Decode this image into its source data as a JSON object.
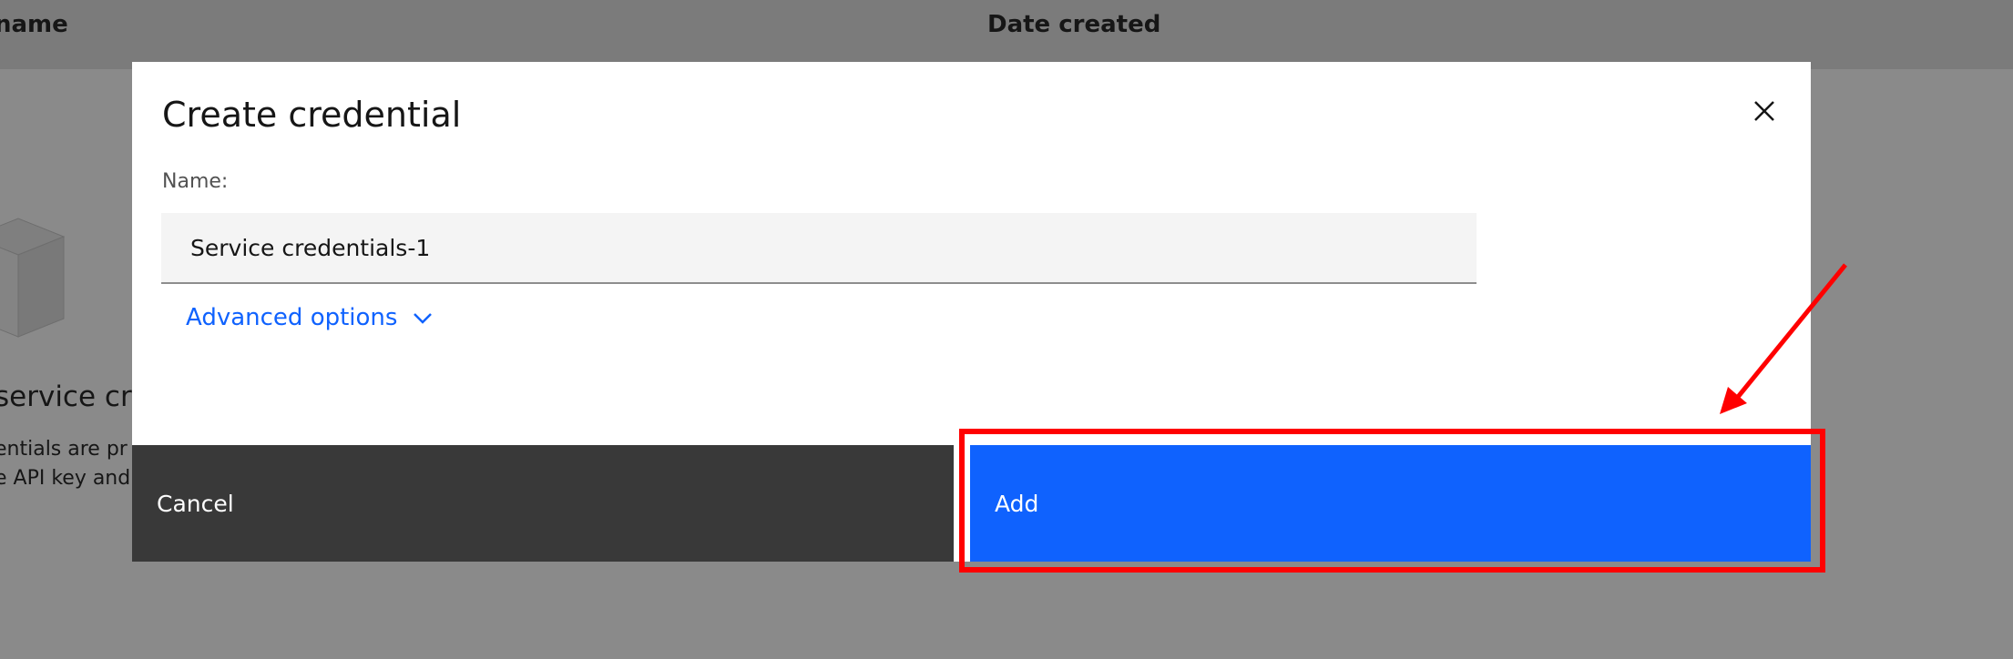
{
  "background": {
    "table": {
      "col_name": "name",
      "col_date": "Date created"
    },
    "empty_state": {
      "title": "service cre",
      "desc_line1": "entials are pr",
      "desc_line2": "e API key and"
    }
  },
  "modal": {
    "title": "Create credential",
    "close_icon": "close-icon",
    "name_label": "Name:",
    "name_value": "Service credentials-1",
    "advanced_label": "Advanced options",
    "advanced_icon": "chevron-down-icon",
    "cancel_label": "Cancel",
    "add_label": "Add"
  },
  "colors": {
    "primary": "#0f62fe",
    "secondary": "#393939",
    "annotation": "#ff0000"
  }
}
